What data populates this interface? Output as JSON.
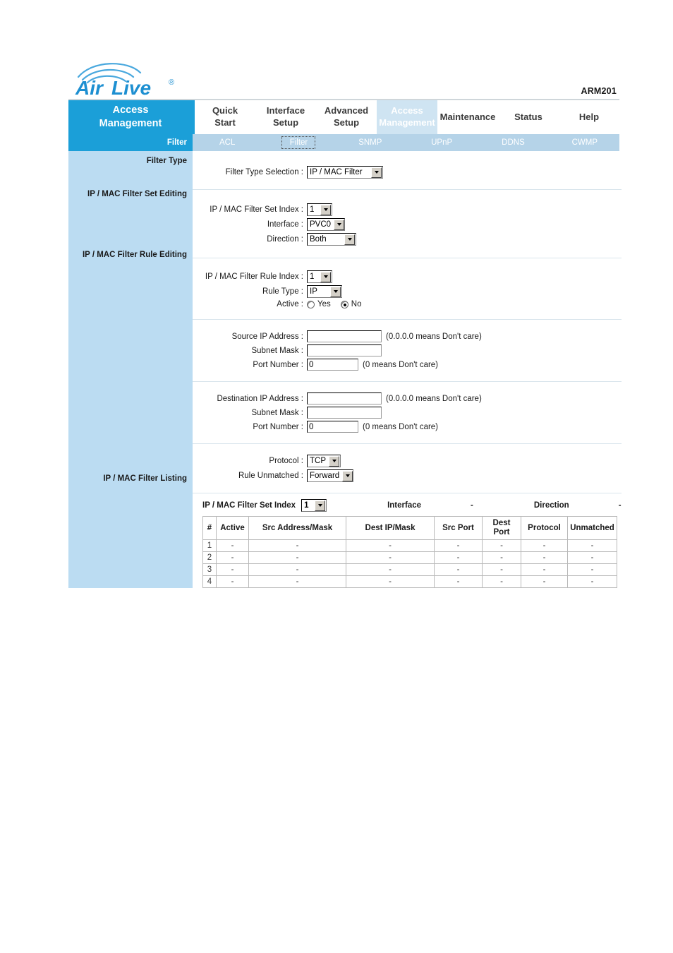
{
  "header": {
    "logo_text_air": "Air",
    "logo_text_live": "Live",
    "logo_reg": "®",
    "model": "ARM201"
  },
  "brand_panel": {
    "line1": "Access",
    "line2": "Management",
    "sub_label": "Filter"
  },
  "nav": {
    "tabs": [
      {
        "line1": "Quick",
        "line2": "Start",
        "active": false
      },
      {
        "line1": "Interface",
        "line2": "Setup",
        "active": false
      },
      {
        "line1": "Advanced",
        "line2": "Setup",
        "active": false
      },
      {
        "line1": "Access",
        "line2": "Management",
        "active": true
      },
      {
        "line1": "Maintenance",
        "line2": "",
        "active": false
      },
      {
        "line1": "Status",
        "line2": "",
        "active": false
      },
      {
        "line1": "Help",
        "line2": "",
        "active": false
      }
    ],
    "subtabs": [
      {
        "label": "ACL",
        "focused": false
      },
      {
        "label": "Filter",
        "focused": true
      },
      {
        "label": "SNMP",
        "focused": false
      },
      {
        "label": "UPnP",
        "focused": false
      },
      {
        "label": "DDNS",
        "focused": false
      },
      {
        "label": "CWMP",
        "focused": false
      }
    ]
  },
  "sidebar": {
    "labels": [
      "Filter Type",
      "IP / MAC Filter Set Editing",
      "IP / MAC Filter Rule Editing",
      "IP / MAC Filter Listing"
    ]
  },
  "filter_type": {
    "selection_label": "Filter Type Selection :",
    "selection_value": "IP / MAC Filter"
  },
  "set_editing": {
    "set_index_label": "IP / MAC Filter Set Index :",
    "set_index_value": "1",
    "interface_label": "Interface :",
    "interface_value": "PVC0",
    "direction_label": "Direction :",
    "direction_value": "Both"
  },
  "rule_editing": {
    "rule_index_label": "IP / MAC Filter Rule Index :",
    "rule_index_value": "1",
    "rule_type_label": "Rule Type :",
    "rule_type_value": "IP",
    "active_label": "Active :",
    "active_yes": "Yes",
    "active_no": "No",
    "active_selected": "No"
  },
  "source": {
    "ip_label": "Source IP Address :",
    "ip_value": "",
    "ip_hint": "(0.0.0.0 means Don't care)",
    "mask_label": "Subnet Mask :",
    "mask_value": "",
    "port_label": "Port Number :",
    "port_value": "0",
    "port_hint": "(0 means Don't care)"
  },
  "destination": {
    "ip_label": "Destination IP Address :",
    "ip_value": "",
    "ip_hint": "(0.0.0.0 means Don't care)",
    "mask_label": "Subnet Mask :",
    "mask_value": "",
    "port_label": "Port Number :",
    "port_value": "0",
    "port_hint": "(0 means Don't care)"
  },
  "protocol_section": {
    "protocol_label": "Protocol :",
    "protocol_value": "TCP",
    "unmatched_label": "Rule Unmatched :",
    "unmatched_value": "Forward"
  },
  "listing": {
    "set_index_label": "IP / MAC Filter Set Index",
    "set_index_value": "1",
    "interface_label": "Interface",
    "interface_value": "-",
    "direction_label": "Direction",
    "direction_value": "-",
    "columns": [
      "#",
      "Active",
      "Src Address/Mask",
      "Dest IP/Mask",
      "Src Port",
      "Dest Port",
      "Protocol",
      "Unmatched"
    ],
    "column_dest_port_l1": "Dest",
    "column_dest_port_l2": "Port",
    "rows": [
      {
        "num": "1",
        "active": "-",
        "src": "-",
        "dest": "-",
        "src_port": "-",
        "dest_port": "-",
        "protocol": "-",
        "unmatched": "-"
      },
      {
        "num": "2",
        "active": "-",
        "src": "-",
        "dest": "-",
        "src_port": "-",
        "dest_port": "-",
        "protocol": "-",
        "unmatched": "-"
      },
      {
        "num": "3",
        "active": "-",
        "src": "-",
        "dest": "-",
        "src_port": "-",
        "dest_port": "-",
        "protocol": "-",
        "unmatched": "-"
      },
      {
        "num": "4",
        "active": "-",
        "src": "-",
        "dest": "-",
        "src_port": "-",
        "dest_port": "-",
        "protocol": "-",
        "unmatched": "-"
      }
    ]
  },
  "colors": {
    "brand_blue": "#1b9fd8",
    "sidebar_blue": "#bbdcf2",
    "subnav_blue": "#b5d3e8",
    "active_tab": "#cfe4f2",
    "logo_blue": "#1d8fd1"
  }
}
